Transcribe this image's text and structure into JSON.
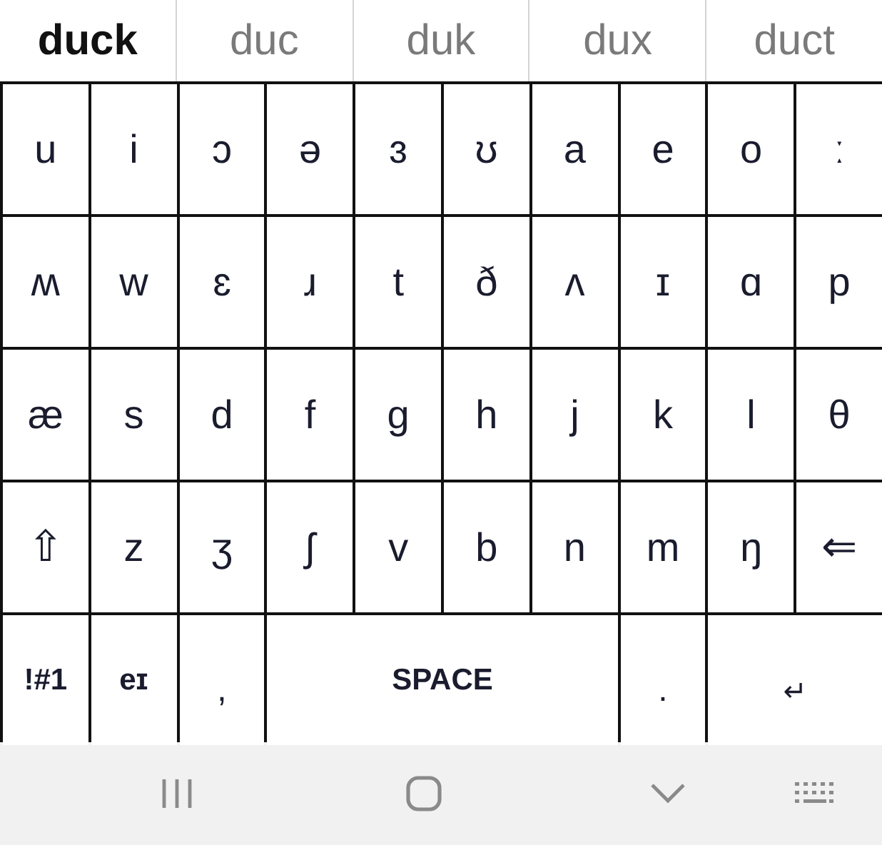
{
  "suggestions": [
    {
      "label": "duck",
      "selected": true
    },
    {
      "label": "duc",
      "selected": false
    },
    {
      "label": "duk",
      "selected": false
    },
    {
      "label": "dux",
      "selected": false
    },
    {
      "label": "duct",
      "selected": false
    }
  ],
  "keyboard": {
    "rows": [
      {
        "keys": [
          {
            "label": "u",
            "kind": "letter"
          },
          {
            "label": "i",
            "kind": "letter"
          },
          {
            "label": "ɔ",
            "kind": "letter"
          },
          {
            "label": "ə",
            "kind": "letter"
          },
          {
            "label": "ɜ",
            "kind": "letter"
          },
          {
            "label": "ʊ",
            "kind": "letter"
          },
          {
            "label": "a",
            "kind": "letter"
          },
          {
            "label": "e",
            "kind": "letter"
          },
          {
            "label": "o",
            "kind": "letter"
          },
          {
            "label": "ː",
            "kind": "letter"
          }
        ]
      },
      {
        "keys": [
          {
            "label": "ʍ",
            "kind": "letter"
          },
          {
            "label": "w",
            "kind": "letter"
          },
          {
            "label": "ɛ",
            "kind": "letter"
          },
          {
            "label": "ɹ",
            "kind": "letter"
          },
          {
            "label": "t",
            "kind": "letter"
          },
          {
            "label": "ð",
            "kind": "letter"
          },
          {
            "label": "ʌ",
            "kind": "letter"
          },
          {
            "label": "ɪ",
            "kind": "letter"
          },
          {
            "label": "ɑ",
            "kind": "letter"
          },
          {
            "label": "p",
            "kind": "letter"
          }
        ]
      },
      {
        "keys": [
          {
            "label": "æ",
            "kind": "letter"
          },
          {
            "label": "s",
            "kind": "letter"
          },
          {
            "label": "d",
            "kind": "letter"
          },
          {
            "label": "f",
            "kind": "letter"
          },
          {
            "label": "g",
            "kind": "letter"
          },
          {
            "label": "h",
            "kind": "letter"
          },
          {
            "label": "j",
            "kind": "letter"
          },
          {
            "label": "k",
            "kind": "letter"
          },
          {
            "label": "l",
            "kind": "letter"
          },
          {
            "label": "θ",
            "kind": "letter"
          }
        ]
      },
      {
        "keys": [
          {
            "label": "⇧",
            "kind": "shift"
          },
          {
            "label": "z",
            "kind": "letter"
          },
          {
            "label": "ʒ",
            "kind": "letter"
          },
          {
            "label": "ʃ",
            "kind": "letter"
          },
          {
            "label": "v",
            "kind": "letter"
          },
          {
            "label": "b",
            "kind": "letter"
          },
          {
            "label": "n",
            "kind": "letter"
          },
          {
            "label": "m",
            "kind": "letter"
          },
          {
            "label": "ŋ",
            "kind": "letter"
          },
          {
            "label": "⇐",
            "kind": "backspace"
          }
        ]
      },
      {
        "keys": [
          {
            "label": "!#1",
            "kind": "function"
          },
          {
            "label": "eɪ",
            "kind": "function"
          },
          {
            "label": ",",
            "kind": "punct"
          },
          {
            "label": "SPACE",
            "kind": "space"
          },
          {
            "label": ".",
            "kind": "punct"
          },
          {
            "label": "↵",
            "kind": "enter"
          }
        ]
      }
    ]
  },
  "nav_bar": {
    "buttons": [
      {
        "kind": "recents"
      },
      {
        "kind": "home"
      },
      {
        "kind": "back"
      },
      {
        "kind": "keyboard"
      }
    ]
  }
}
